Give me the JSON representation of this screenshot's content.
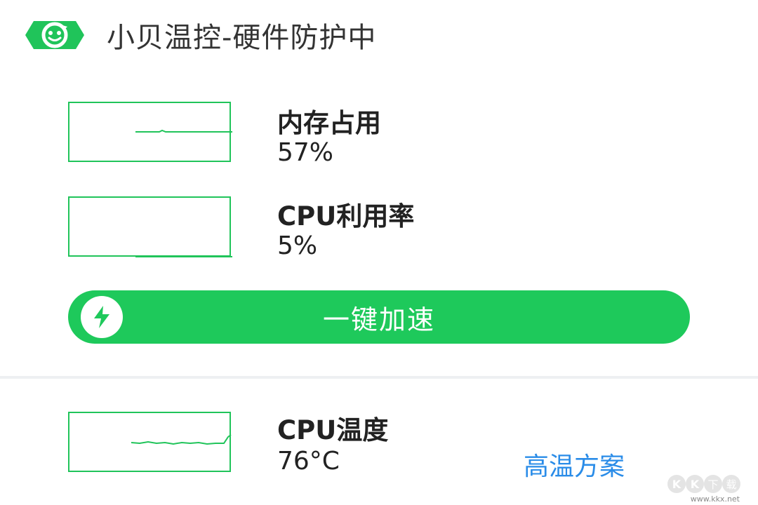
{
  "app": {
    "title": "小贝温控-硬件防护中",
    "logo_icon": "smiley-refresh-icon",
    "accent_color": "#1ec95b"
  },
  "memory": {
    "label": "内存占用",
    "value": "57%",
    "level": 0.57
  },
  "cpu_usage": {
    "label": "CPU利用率",
    "value": "5%",
    "level": 0.05
  },
  "boost": {
    "label": "一键加速",
    "icon": "lightning-icon"
  },
  "cpu_temp": {
    "label": "CPU温度",
    "value": "76°C",
    "action_label": "高温方案",
    "link_color": "#2a8ce8"
  },
  "watermark": {
    "text": "KK下载",
    "url": "www.kkx.net"
  }
}
